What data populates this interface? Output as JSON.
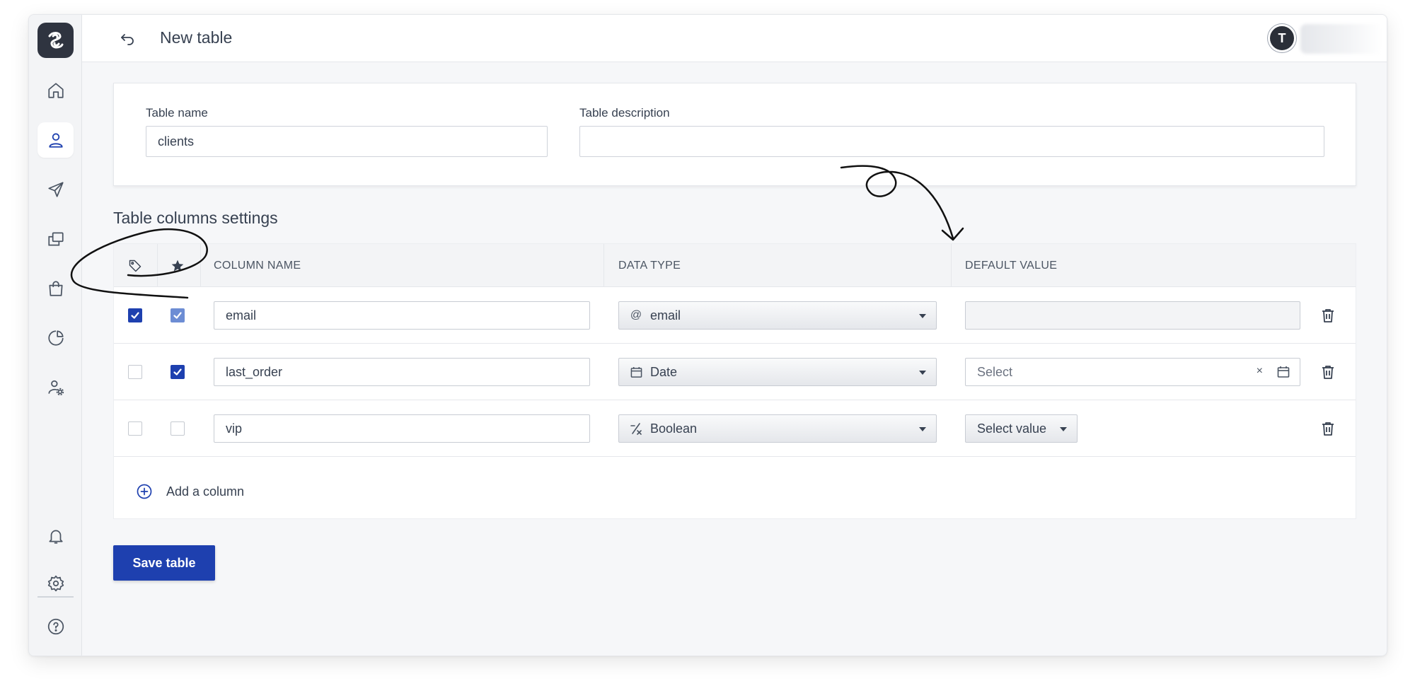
{
  "header": {
    "back_icon": "undo-arrow-icon",
    "title": "New table",
    "avatar_initial": "T"
  },
  "sidebar": {
    "logo_icon": "brand-logo-icon",
    "items": [
      {
        "icon": "home-icon",
        "active": false
      },
      {
        "icon": "user-icon",
        "active": true
      },
      {
        "icon": "send-icon",
        "active": false
      },
      {
        "icon": "copy-icon",
        "active": false
      },
      {
        "icon": "shopping-bag-icon",
        "active": false
      },
      {
        "icon": "pie-chart-icon",
        "active": false
      },
      {
        "icon": "user-settings-icon",
        "active": false
      }
    ],
    "bottom_items": [
      {
        "icon": "bell-icon"
      },
      {
        "icon": "gear-icon"
      },
      {
        "icon": "help-icon"
      }
    ]
  },
  "form": {
    "table_name_label": "Table name",
    "table_name_value": "clients",
    "table_description_label": "Table description",
    "table_description_value": ""
  },
  "columns_section": {
    "title": "Table columns settings",
    "headers": {
      "tag_icon": "tag-icon",
      "star_icon": "star-icon",
      "column_name": "COLUMN NAME",
      "data_type": "DATA TYPE",
      "default_value": "DEFAULT VALUE"
    },
    "rows": [
      {
        "tag_checked": true,
        "star_checked": true,
        "name": "email",
        "type_icon": "at-sign-icon",
        "type_glyph": "@",
        "type": "email",
        "default_kind": "text",
        "default_value": ""
      },
      {
        "tag_checked": false,
        "star_checked": true,
        "name": "last_order",
        "type_icon": "calendar-icon",
        "type": "Date",
        "default_kind": "date",
        "default_placeholder": "Select"
      },
      {
        "tag_checked": false,
        "star_checked": false,
        "name": "vip",
        "type_icon": "boolean-icon",
        "type_glyph": "⁄",
        "type": "Boolean",
        "default_kind": "select",
        "default_placeholder": "Select value"
      }
    ],
    "add_column_label": "Add a column"
  },
  "actions": {
    "save_label": "Save table"
  },
  "colors": {
    "primary": "#1e40af",
    "sidebar_bg": "#f3f4f6",
    "page_bg": "#f6f7f9"
  }
}
